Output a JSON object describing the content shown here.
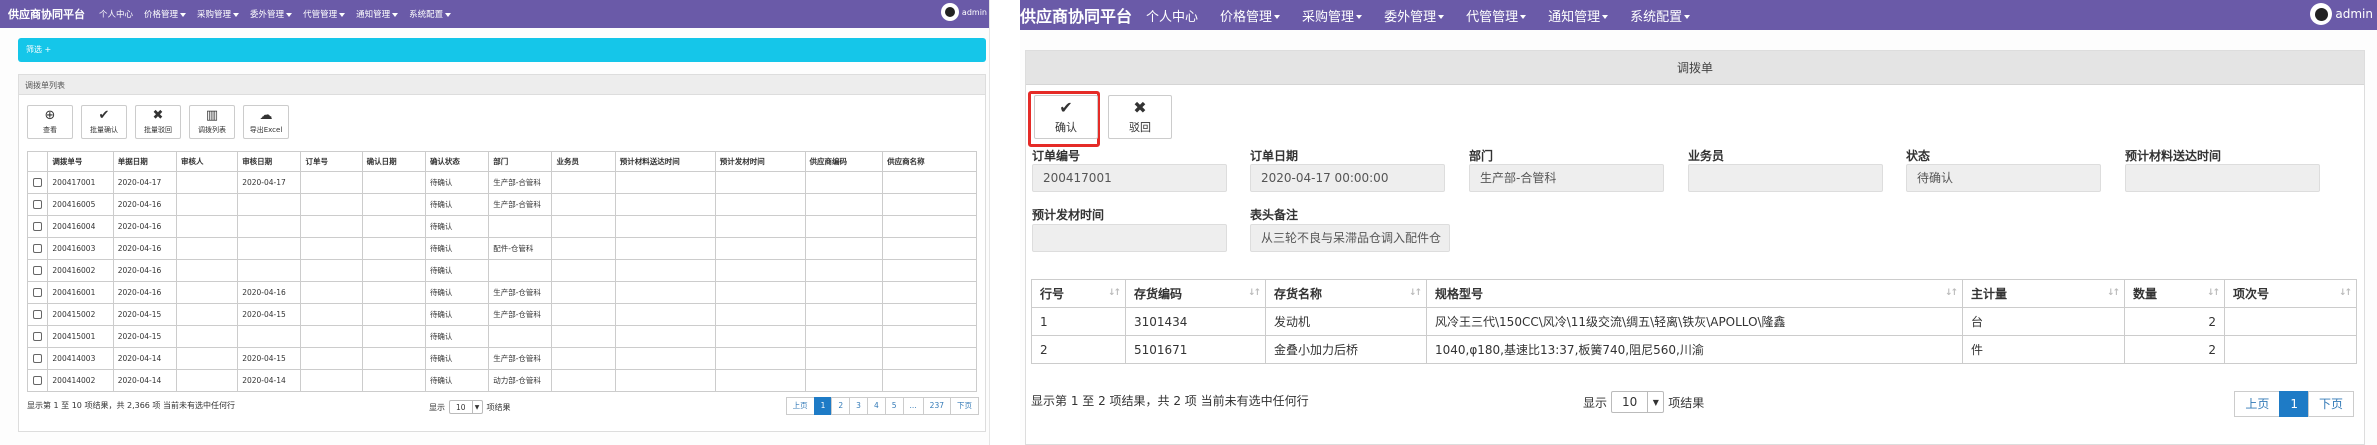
{
  "nav": {
    "brand": "供应商协同平台",
    "items": [
      "个人中心",
      "价格管理",
      "采购管理",
      "委外管理",
      "代管管理",
      "通知管理",
      "系统配置"
    ],
    "dropdown": [
      false,
      true,
      true,
      true,
      true,
      true,
      true
    ],
    "user": "admin"
  },
  "left": {
    "filter_label": "筛选 +",
    "panel_title": "调拨单列表",
    "toolbar": [
      {
        "icon": "zoom-in-icon",
        "glyph": "⊕",
        "label": "查看"
      },
      {
        "icon": "check-icon",
        "glyph": "✔",
        "label": "批量确认"
      },
      {
        "icon": "close-icon",
        "glyph": "✖",
        "label": "批量驳回"
      },
      {
        "icon": "bar-chart-icon",
        "glyph": "▥",
        "label": "调拨列表"
      },
      {
        "icon": "cloud-download-icon",
        "glyph": "☁",
        "label": "导出Excel"
      }
    ],
    "columns": [
      "",
      "调拨单号",
      "单据日期",
      "审核人",
      "审核日期",
      "订单号",
      "确认日期",
      "确认状态",
      "部门",
      "业务员",
      "预计材料送达时间",
      "预计发材时间",
      "供应商编码",
      "供应商名称"
    ],
    "rows": [
      [
        "200417001",
        "2020-04-17",
        "",
        "2020-04-17",
        "",
        "",
        "待确认",
        "生产部-合管科",
        "",
        "",
        "",
        "",
        ""
      ],
      [
        "200416005",
        "2020-04-16",
        "",
        "",
        "",
        "",
        "待确认",
        "生产部-合管科",
        "",
        "",
        "",
        "",
        ""
      ],
      [
        "200416004",
        "2020-04-16",
        "",
        "",
        "",
        "",
        "待确认",
        "",
        "",
        "",
        "",
        "",
        ""
      ],
      [
        "200416003",
        "2020-04-16",
        "",
        "",
        "",
        "",
        "待确认",
        "配件-仓管科",
        "",
        "",
        "",
        "",
        ""
      ],
      [
        "200416002",
        "2020-04-16",
        "",
        "",
        "",
        "",
        "待确认",
        "",
        "",
        "",
        "",
        "",
        ""
      ],
      [
        "200416001",
        "2020-04-16",
        "",
        "2020-04-16",
        "",
        "",
        "待确认",
        "生产部-仓管科",
        "",
        "",
        "",
        "",
        ""
      ],
      [
        "200415002",
        "2020-04-15",
        "",
        "2020-04-15",
        "",
        "",
        "待确认",
        "生产部-仓管科",
        "",
        "",
        "",
        "",
        ""
      ],
      [
        "200415001",
        "2020-04-15",
        "",
        "",
        "",
        "",
        "待确认",
        "",
        "",
        "",
        "",
        "",
        ""
      ],
      [
        "200414003",
        "2020-04-14",
        "",
        "2020-04-15",
        "",
        "",
        "待确认",
        "生产部-仓管科",
        "",
        "",
        "",
        "",
        ""
      ],
      [
        "200414002",
        "2020-04-14",
        "",
        "2020-04-14",
        "",
        "",
        "待确认",
        "动力部-仓管科",
        "",
        "",
        "",
        "",
        ""
      ]
    ],
    "footer_info": "显示第 1 至 10 项结果，共 2,366 项   当前未有选中任何行",
    "page_size_prefix": "显示",
    "page_size": "10",
    "page_size_suffix": "项结果",
    "pager": [
      "上页",
      "1",
      "2",
      "3",
      "4",
      "5",
      "...",
      "237",
      "下页"
    ],
    "active_page": "1"
  },
  "right": {
    "panel_title": "调拨单",
    "buttons": [
      {
        "icon": "check-icon",
        "glyph": "✔",
        "label": "确认"
      },
      {
        "icon": "close-icon",
        "glyph": "✖",
        "label": "驳回"
      }
    ],
    "fields_row1": [
      {
        "label": "订单编号",
        "value": "200417001"
      },
      {
        "label": "订单日期",
        "value": "2020-04-17 00:00:00"
      },
      {
        "label": "部门",
        "value": "生产部-合管科"
      },
      {
        "label": "业务员",
        "value": ""
      },
      {
        "label": "状态",
        "value": "待确认"
      },
      {
        "label": "预计材料送达时间",
        "value": ""
      }
    ],
    "fields_row2": [
      {
        "label": "预计发材时间",
        "value": ""
      },
      {
        "label": "表头备注",
        "value": "从三轮不良与呆滞品仓调入配件仓"
      }
    ],
    "columns": [
      "行号",
      "存货编码",
      "存货名称",
      "规格型号",
      "主计量",
      "数量",
      "项次号"
    ],
    "rows": [
      [
        "1",
        "3101434",
        "发动机",
        "风冷王三代\\150CC\\风冷\\11级交流\\绸五\\轻离\\铁灰\\APOLLO\\隆鑫",
        "台",
        "2",
        ""
      ],
      [
        "2",
        "5101671",
        "金叠小加力后桥",
        "1040,φ180,基速比13:37,板簧740,阻尼560,川渝",
        "件",
        "2",
        ""
      ]
    ],
    "footer_info": "显示第 1 至 2 项结果，共 2 项   当前未有选中任何行",
    "page_size_prefix": "显示",
    "page_size": "10",
    "page_size_suffix": "项结果",
    "pager": [
      "上页",
      "1",
      "下页"
    ],
    "active_page": "1"
  }
}
